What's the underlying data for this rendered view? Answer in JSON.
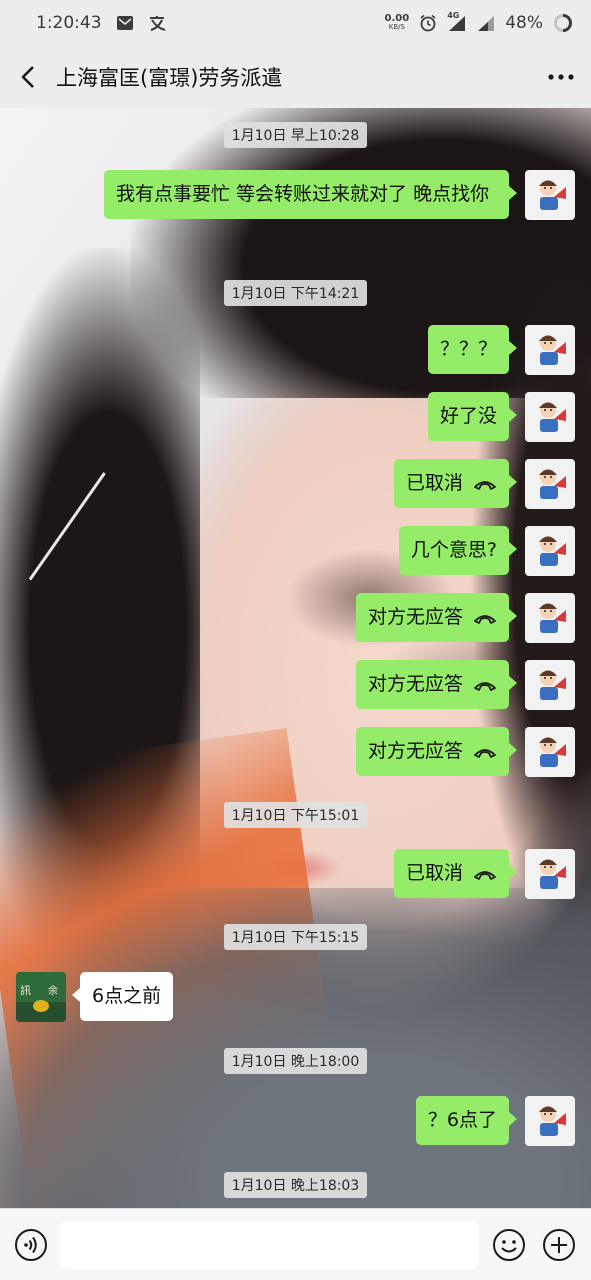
{
  "status_bar": {
    "time": "1:20:43",
    "speed_value": "0.00",
    "speed_unit": "KB/S",
    "network": "4G",
    "battery": "48%"
  },
  "header": {
    "title": "上海富匡(富璟)劳务派遣"
  },
  "messages": [
    {
      "type": "time",
      "text": "1月10日 早上10:28"
    },
    {
      "type": "out",
      "text": "我有点事要忙 等会转账过来就对了 晚点找你"
    },
    {
      "type": "time",
      "text": "1月10日 下午14:21"
    },
    {
      "type": "out",
      "text": "？？？"
    },
    {
      "type": "out",
      "text": "好了没"
    },
    {
      "type": "out",
      "text": "已取消",
      "icon": "call-icon"
    },
    {
      "type": "out",
      "text": "几个意思?"
    },
    {
      "type": "out",
      "text": "对方无应答",
      "icon": "call-icon"
    },
    {
      "type": "out",
      "text": "对方无应答",
      "icon": "call-icon"
    },
    {
      "type": "out",
      "text": "对方无应答",
      "icon": "call-icon"
    },
    {
      "type": "time",
      "text": "1月10日 下午15:01"
    },
    {
      "type": "out",
      "text": "已取消",
      "icon": "call-icon"
    },
    {
      "type": "time",
      "text": "1月10日 下午15:15"
    },
    {
      "type": "in",
      "text": "6点之前"
    },
    {
      "type": "time",
      "text": "1月10日 晚上18:00"
    },
    {
      "type": "out",
      "text": "？6点了"
    },
    {
      "type": "time",
      "text": "1月10日 晚上18:03"
    }
  ],
  "input_bar": {
    "placeholder": ""
  },
  "colors": {
    "outgoing_bubble": "#95ec69",
    "incoming_bubble": "#ffffff",
    "bar_background": "#ededed"
  }
}
